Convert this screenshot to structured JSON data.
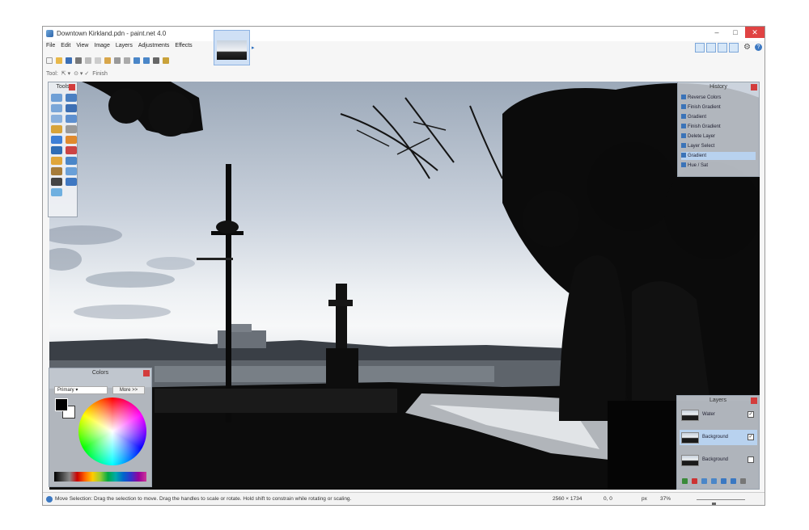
{
  "app": {
    "title": "Downtown Kirkland.pdn - paint.net 4.0",
    "window_buttons": {
      "minimize": "–",
      "maximize": "□",
      "close": "✕"
    }
  },
  "menu": [
    "File",
    "Edit",
    "View",
    "Image",
    "Layers",
    "Adjustments",
    "Effects"
  ],
  "toolbar": {
    "tool_label": "Tool:",
    "finish_label": "Finish",
    "icons": [
      "new-icon",
      "open-icon",
      "save-icon",
      "print-icon",
      "cut-icon",
      "copy-icon",
      "paste-icon",
      "crop-icon",
      "deselect-icon",
      "undo-icon",
      "redo-icon",
      "grid-icon",
      "ruler-icon"
    ]
  },
  "image_tab": {
    "name": "Downtown Kirkland"
  },
  "tools_panel": {
    "title": "Tools",
    "icons": [
      "rectangle-select-icon",
      "move-selection-icon",
      "lasso-select-icon",
      "move-pixels-icon",
      "ellipse-select-icon",
      "zoom-icon",
      "magic-wand-icon",
      "pan-icon",
      "paint-bucket-icon",
      "gradient-icon",
      "paintbrush-icon",
      "eraser-icon",
      "pencil-icon",
      "color-picker-icon",
      "clone-stamp-icon",
      "recolor-icon",
      "text-icon",
      "line-icon",
      "shapes-icon"
    ]
  },
  "history_panel": {
    "title": "History",
    "items": [
      "Reverse Colors",
      "Finish Gradient",
      "Gradient",
      "Finish Gradient",
      "Delete Layer",
      "Layer Select",
      "Gradient",
      "Hue / Sat"
    ],
    "selected_index": 6
  },
  "colors_panel": {
    "title": "Colors",
    "mode": "Primary",
    "more_button": "More >>",
    "primary_color": "#000000",
    "secondary_color": "#ffffff"
  },
  "layers_panel": {
    "title": "Layers",
    "layers": [
      {
        "name": "Water",
        "visible": true
      },
      {
        "name": "Background",
        "visible": true,
        "selected": true
      },
      {
        "name": "Background",
        "visible": false
      }
    ],
    "tools": [
      "add-layer-icon",
      "delete-layer-icon",
      "duplicate-layer-icon",
      "merge-layer-icon",
      "move-up-icon",
      "move-down-icon",
      "layer-properties-icon"
    ]
  },
  "status": {
    "message": "Move Selection: Drag the selection to move. Drag the handles to scale or rotate. Hold shift to constrain while rotating or scaling.",
    "image_size": "2560 × 1734",
    "cursor": "0, 0",
    "unit": "px",
    "zoom": "37%",
    "zoom_fraction": 0.35
  },
  "colors": {
    "accent": "#3b78c2",
    "close_red": "#e04343",
    "panel_close": "#d33c3c"
  }
}
